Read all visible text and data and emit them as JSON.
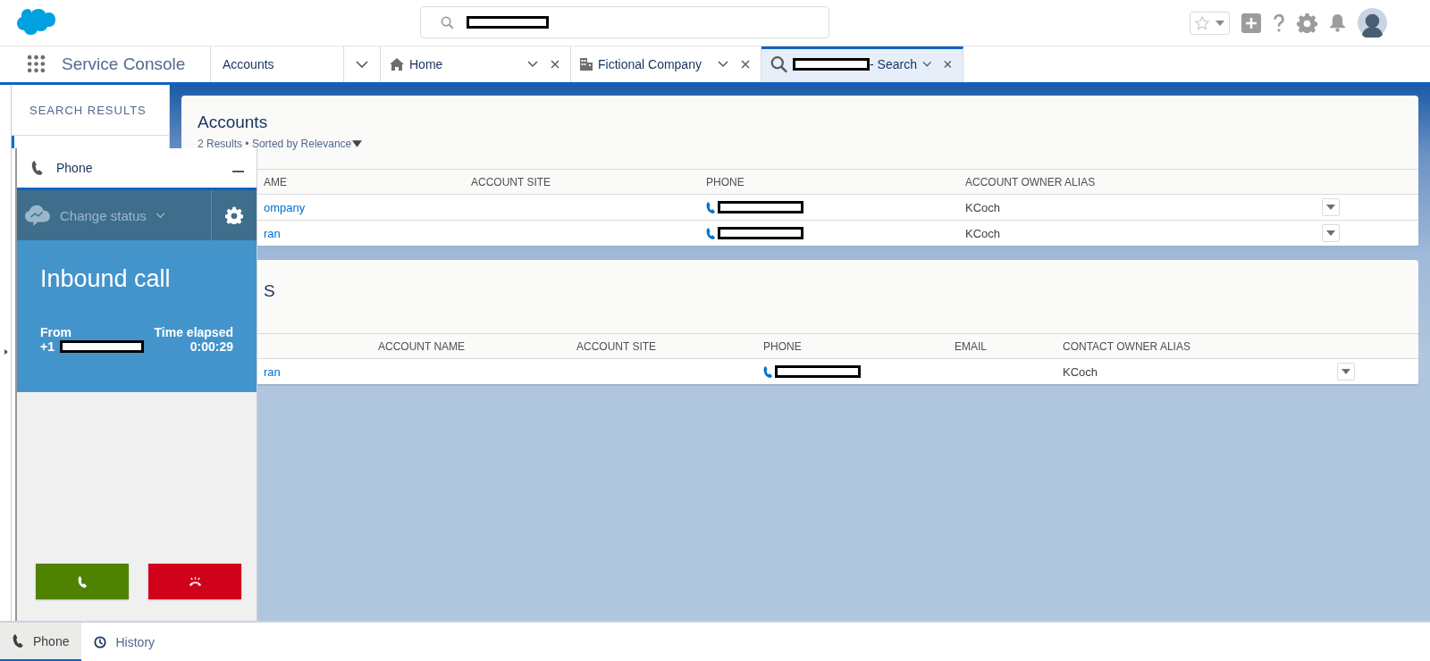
{
  "header": {
    "search": {
      "redacted": true
    }
  },
  "nav": {
    "app_name": "Service Console",
    "object_tab": "Accounts",
    "tabs": [
      {
        "label": "Home",
        "redacted_prefix": false,
        "selected": false
      },
      {
        "label": "Fictional Company",
        "redacted_prefix": false,
        "selected": false
      },
      {
        "label": "- Search",
        "redacted_prefix": true,
        "selected": true
      }
    ]
  },
  "sidebar": {
    "title": "SEARCH RESULTS"
  },
  "results": [
    {
      "title": "Accounts",
      "subtitle": "2 Results • Sorted by Relevance",
      "columns": [
        "AME",
        "ACCOUNT SITE",
        "PHONE",
        "ACCOUNT OWNER ALIAS"
      ],
      "rows": [
        {
          "cells": [
            {
              "kind": "link",
              "text": "ompany"
            },
            {
              "kind": "blank"
            },
            {
              "kind": "phone",
              "redacted": true
            },
            {
              "kind": "text",
              "text": "KCoch"
            }
          ]
        },
        {
          "cells": [
            {
              "kind": "link",
              "text": "ran"
            },
            {
              "kind": "blank"
            },
            {
              "kind": "phone",
              "redacted": true
            },
            {
              "kind": "text",
              "text": "KCoch"
            }
          ]
        }
      ]
    },
    {
      "title": "S",
      "columns": [
        "ACCOUNT NAME",
        "ACCOUNT SITE",
        "PHONE",
        "EMAIL",
        "CONTACT OWNER ALIAS"
      ],
      "rows": [
        {
          "cells": [
            {
              "kind": "link",
              "text": "ran"
            },
            {
              "kind": "blank"
            },
            {
              "kind": "blank"
            },
            {
              "kind": "phone",
              "redacted": true
            },
            {
              "kind": "blank"
            },
            {
              "kind": "text",
              "text": "KCoch"
            }
          ]
        }
      ]
    }
  ],
  "phone_panel": {
    "title": "Phone",
    "status": "Change status",
    "call_title": "Inbound call",
    "from_label": "From",
    "from_value": "+1",
    "from_redacted": true,
    "elapsed_label": "Time elapsed",
    "elapsed": "0:00:29"
  },
  "utility_bar": [
    {
      "label": "Phone",
      "selected": true
    },
    {
      "label": "History",
      "selected": false
    }
  ]
}
